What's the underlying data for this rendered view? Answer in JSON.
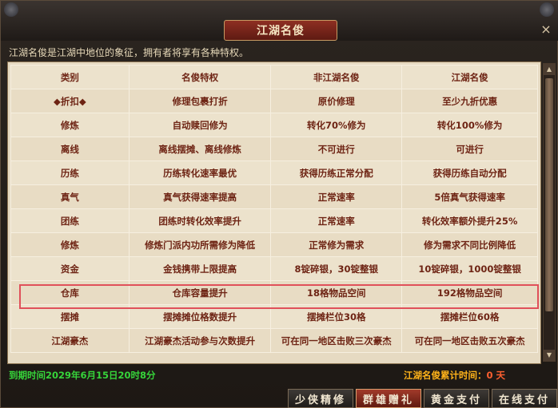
{
  "window": {
    "title": "江湖名俊",
    "close_label": "×"
  },
  "subtitle": "江湖名俊是江湖中地位的象征，拥有者将享有各种特权。",
  "table": {
    "headers": [
      "类别",
      "名俊特权",
      "非江湖名俊",
      "江湖名俊"
    ],
    "rows": [
      [
        "◆折扣◆",
        "修理包裹打折",
        "原价修理",
        "至少九折优惠"
      ],
      [
        "修炼",
        "自动赎回修为",
        "转化70%修为",
        "转化100%修为"
      ],
      [
        "离线",
        "离线摆摊、离线修炼",
        "不可进行",
        "可进行"
      ],
      [
        "历练",
        "历练转化速率最优",
        "获得历练正常分配",
        "获得历练自动分配"
      ],
      [
        "真气",
        "真气获得速率提高",
        "正常速率",
        "5倍真气获得速率"
      ],
      [
        "团练",
        "团练时转化效率提升",
        "正常速率",
        "转化效率额外提升25%"
      ],
      [
        "修炼",
        "修炼门派内功所需修为降低",
        "正常修为需求",
        "修为需求不同比例降低"
      ],
      [
        "资金",
        "金钱携带上限提高",
        "8锭碎银，30锭整银",
        "10锭碎银，1000锭整银"
      ],
      [
        "仓库",
        "仓库容量提升",
        "18格物品空间",
        "192格物品空间"
      ],
      [
        "摆摊",
        "摆摊摊位格数提升",
        "摆摊栏位30格",
        "摆摊栏位60格"
      ],
      [
        "江湖豪杰",
        "江湖豪杰活动参与次数提升",
        "可在同一地区击败三次豪杰",
        "可在同一地区击败五次豪杰"
      ]
    ]
  },
  "footer": {
    "expire_text": "到期时间2029年6月15日20时8分",
    "accum_label": "江湖名俊累计时间：",
    "accum_value": "0 天"
  },
  "tabs": [
    "少侠精修",
    "群雄赠礼",
    "黄金支付",
    "在线支付"
  ],
  "active_tab": 1,
  "highlighted_row": 8,
  "colors": {
    "cell_text": "#6e2414",
    "highlight": "#e0505a",
    "expire": "#36d43a",
    "accum": "#ffb31a"
  }
}
